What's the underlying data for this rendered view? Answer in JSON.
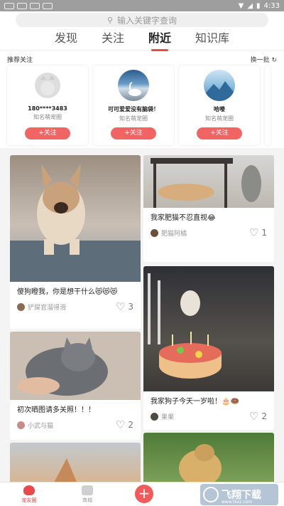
{
  "status": {
    "time": "4:33",
    "left_icons": [
      "qq",
      "qq",
      "app",
      "a"
    ]
  },
  "search": {
    "placeholder": "输入关键字查询"
  },
  "tabs": [
    {
      "label": "发现",
      "active": false
    },
    {
      "label": "关注",
      "active": false
    },
    {
      "label": "附近",
      "active": true
    },
    {
      "label": "知识库",
      "active": false
    }
  ],
  "recommend": {
    "title": "推荐关注",
    "refresh": "换一批",
    "users": [
      {
        "name": "180****3483",
        "group": "知名萌宠圈",
        "follow": "关注"
      },
      {
        "name": "可可爱爱没有脑袋！",
        "group": "知名萌宠圈",
        "follow": "关注"
      },
      {
        "name": "哈喽",
        "group": "知名萌宠圈",
        "follow": "关注"
      }
    ]
  },
  "posts": [
    {
      "caption": "傻狗瞪我，你是想干什么😻😻😻",
      "author": "铲屎官溜得滑",
      "likes": "3"
    },
    {
      "caption": "初次晒图请多关照！！！",
      "author": "小武与猫",
      "likes": "2"
    },
    {
      "caption": "我家肥猫不忍直视😂",
      "author": "肥猫阿橘",
      "likes": "1"
    },
    {
      "caption": "我家狗子今天一岁啦！🎂🍩",
      "author": "果果",
      "likes": "2"
    }
  ],
  "bottom_nav": {
    "home": "宠友圈",
    "mall": "商城",
    "watermark": "飞翔下载",
    "watermark_sub": "www.fxxz.com"
  },
  "colors": {
    "accent": "#e74a4a"
  }
}
